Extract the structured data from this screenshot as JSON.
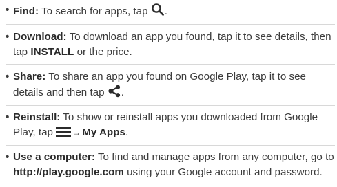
{
  "tips": {
    "find": {
      "bullet": "•",
      "term": "Find:",
      "text": " To search for apps, tap ",
      "icon": "search-icon",
      "end": "."
    },
    "download": {
      "bullet": "•",
      "term": "Download:",
      "text": " To download an app you found, tap it to see details, then tap ",
      "strong1": "INSTALL",
      "text2": " or the price."
    },
    "share": {
      "bullet": "•",
      "term": "Share:",
      "text": " To share an app you found on Google Play, tap it to see details and then tap ",
      "icon": "share-icon",
      "end": "."
    },
    "reinstall": {
      "bullet": "•",
      "term": "Reinstall:",
      "text": " To show or reinstall apps you downloaded from Google Play, tap ",
      "icon": "menu-icon",
      "arrow": "→",
      "strong1": "My Apps",
      "end": "."
    },
    "computer": {
      "bullet": "•",
      "term": "Use a computer:",
      "text": " To find and manage apps from any computer, go to ",
      "link": "http://play.google.com",
      "text2": " using your Google account and password."
    }
  }
}
